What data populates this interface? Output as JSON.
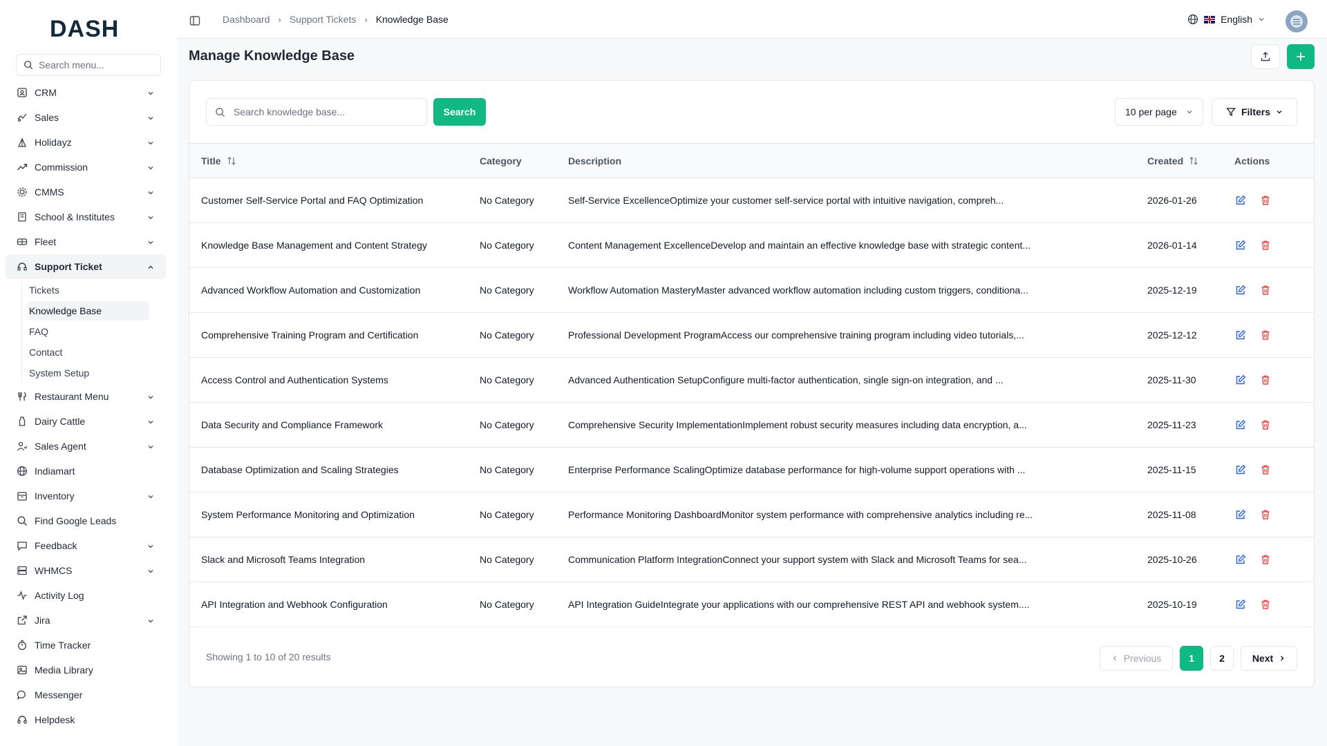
{
  "app": {
    "logo_text": "DASH"
  },
  "sidebar": {
    "search_placeholder": "Search menu...",
    "items": [
      {
        "label": "CRM",
        "icon": "crm-icon",
        "expandable": true
      },
      {
        "label": "Sales",
        "icon": "sales-icon",
        "expandable": true
      },
      {
        "label": "Holidayz",
        "icon": "holidayz-icon",
        "expandable": true
      },
      {
        "label": "Commission",
        "icon": "commission-icon",
        "expandable": true
      },
      {
        "label": "CMMS",
        "icon": "cmms-icon",
        "expandable": true
      },
      {
        "label": "School & Institutes",
        "icon": "school-icon",
        "expandable": true
      },
      {
        "label": "Fleet",
        "icon": "fleet-icon",
        "expandable": true
      },
      {
        "label": "Support Ticket",
        "icon": "support-icon",
        "expandable": true,
        "expanded": true
      },
      {
        "label": "Restaurant Menu",
        "icon": "restaurant-icon",
        "expandable": true
      },
      {
        "label": "Dairy Cattle",
        "icon": "dairy-icon",
        "expandable": true
      },
      {
        "label": "Sales Agent",
        "icon": "sales-agent-icon",
        "expandable": true
      },
      {
        "label": "Indiamart",
        "icon": "globe-icon",
        "expandable": false
      },
      {
        "label": "Inventory",
        "icon": "inventory-icon",
        "expandable": true
      },
      {
        "label": "Find Google Leads",
        "icon": "search-icon",
        "expandable": false
      },
      {
        "label": "Feedback",
        "icon": "feedback-icon",
        "expandable": true
      },
      {
        "label": "WHMCS",
        "icon": "server-icon",
        "expandable": true
      },
      {
        "label": "Activity Log",
        "icon": "activity-icon",
        "expandable": false
      },
      {
        "label": "Jira",
        "icon": "external-link-icon",
        "expandable": true
      },
      {
        "label": "Time Tracker",
        "icon": "timer-icon",
        "expandable": false
      },
      {
        "label": "Media Library",
        "icon": "image-icon",
        "expandable": false
      },
      {
        "label": "Messenger",
        "icon": "message-icon",
        "expandable": false
      },
      {
        "label": "Helpdesk",
        "icon": "headset-icon",
        "expandable": false
      }
    ],
    "support_subitems": [
      "Tickets",
      "Knowledge Base",
      "FAQ",
      "Contact",
      "System Setup"
    ],
    "active_subitem": "Knowledge Base"
  },
  "topbar": {
    "breadcrumbs": [
      "Dashboard",
      "Support Tickets",
      "Knowledge Base"
    ],
    "language": "English"
  },
  "page": {
    "title": "Manage Knowledge Base",
    "search_placeholder": "Search knowledge base...",
    "search_button": "Search",
    "per_page": "10 per page",
    "filters_label": "Filters"
  },
  "table": {
    "headers": {
      "title": "Title",
      "category": "Category",
      "description": "Description",
      "created": "Created",
      "actions": "Actions"
    },
    "rows": [
      {
        "title": "Customer Self-Service Portal and FAQ Optimization",
        "category": "No Category",
        "description": "Self-Service ExcellenceOptimize your customer self-service portal with intuitive navigation, compreh...",
        "created": "2026-01-26"
      },
      {
        "title": "Knowledge Base Management and Content Strategy",
        "category": "No Category",
        "description": "Content Management ExcellenceDevelop and maintain an effective knowledge base with strategic content...",
        "created": "2026-01-14"
      },
      {
        "title": "Advanced Workflow Automation and Customization",
        "category": "No Category",
        "description": "Workflow Automation MasteryMaster advanced workflow automation including custom triggers, conditiona...",
        "created": "2025-12-19"
      },
      {
        "title": "Comprehensive Training Program and Certification",
        "category": "No Category",
        "description": "Professional Development ProgramAccess our comprehensive training program including video tutorials,...",
        "created": "2025-12-12"
      },
      {
        "title": "Access Control and Authentication Systems",
        "category": "No Category",
        "description": "Advanced Authentication SetupConfigure multi-factor authentication, single sign-on integration, and ...",
        "created": "2025-11-30"
      },
      {
        "title": "Data Security and Compliance Framework",
        "category": "No Category",
        "description": "Comprehensive Security ImplementationImplement robust security measures including data encryption, a...",
        "created": "2025-11-23"
      },
      {
        "title": "Database Optimization and Scaling Strategies",
        "category": "No Category",
        "description": "Enterprise Performance ScalingOptimize database performance for high-volume support operations with ...",
        "created": "2025-11-15"
      },
      {
        "title": "System Performance Monitoring and Optimization",
        "category": "No Category",
        "description": "Performance Monitoring DashboardMonitor system performance with comprehensive analytics including re...",
        "created": "2025-11-08"
      },
      {
        "title": "Slack and Microsoft Teams Integration",
        "category": "No Category",
        "description": "Communication Platform IntegrationConnect your support system with Slack and Microsoft Teams for sea...",
        "created": "2025-10-26"
      },
      {
        "title": "API Integration and Webhook Configuration",
        "category": "No Category",
        "description": "API Integration GuideIntegrate your applications with our comprehensive REST API and webhook system....",
        "created": "2025-10-19"
      }
    ]
  },
  "pagination": {
    "summary": "Showing 1 to 10 of 20 results",
    "previous": "Previous",
    "next": "Next",
    "pages": [
      "1",
      "2"
    ],
    "current": "1"
  },
  "colors": {
    "accent": "#10b981",
    "edit": "#2563eb",
    "delete": "#ef4444"
  }
}
